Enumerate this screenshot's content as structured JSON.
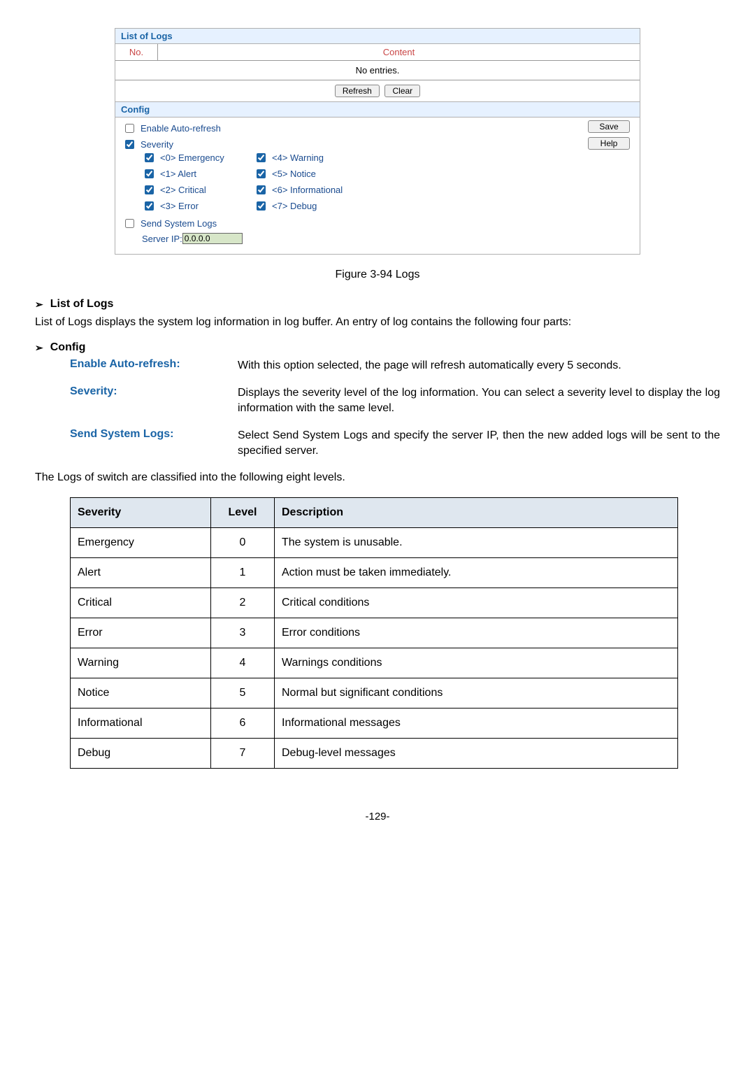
{
  "panel": {
    "list_title": "List of Logs",
    "col_no": "No.",
    "col_content": "Content",
    "no_entries": "No entries.",
    "refresh": "Refresh",
    "clear": "Clear",
    "config_title": "Config",
    "enable_auto": "Enable Auto-refresh",
    "severity": "Severity",
    "save": "Save",
    "help": "Help",
    "sev0": "<0> Emergency",
    "sev1": "<1> Alert",
    "sev2": "<2> Critical",
    "sev3": "<3> Error",
    "sev4": "<4> Warning",
    "sev5": "<5> Notice",
    "sev6": "<6> Informational",
    "sev7": "<7> Debug",
    "send_syslogs": "Send System Logs",
    "server_ip_label": "Server IP: ",
    "server_ip_value": "0.0.0.0"
  },
  "caption": "Figure 3-94 Logs",
  "h_list": "List of Logs",
  "p_list": "List of Logs displays the system log information in log buffer. An entry of log contains the following four parts:",
  "h_config": "Config",
  "defs": {
    "auto_t": "Enable Auto-refresh:",
    "auto_d": "With this option selected, the page will refresh automatically every 5 seconds.",
    "sev_t": "Severity:",
    "sev_d": "Displays the severity level of the log information. You can select a severity level to display the log information with the same level.",
    "send_t": "Send System Logs:",
    "send_d": "Select Send System Logs and specify the server IP, then the new added logs will be sent to the specified server."
  },
  "p_levels": "The Logs of switch are classified into the following eight levels.",
  "table": {
    "h_sev": "Severity",
    "h_level": "Level",
    "h_desc": "Description",
    "rows": [
      {
        "sev": "Emergency",
        "level": "0",
        "desc": "The system is unusable."
      },
      {
        "sev": "Alert",
        "level": "1",
        "desc": "Action must be taken immediately."
      },
      {
        "sev": "Critical",
        "level": "2",
        "desc": "Critical conditions"
      },
      {
        "sev": "Error",
        "level": "3",
        "desc": "Error conditions"
      },
      {
        "sev": "Warning",
        "level": "4",
        "desc": "Warnings conditions"
      },
      {
        "sev": "Notice",
        "level": "5",
        "desc": "Normal but significant conditions"
      },
      {
        "sev": "Informational",
        "level": "6",
        "desc": "Informational messages"
      },
      {
        "sev": "Debug",
        "level": "7",
        "desc": "Debug-level messages"
      }
    ]
  },
  "page_num": "-129-"
}
